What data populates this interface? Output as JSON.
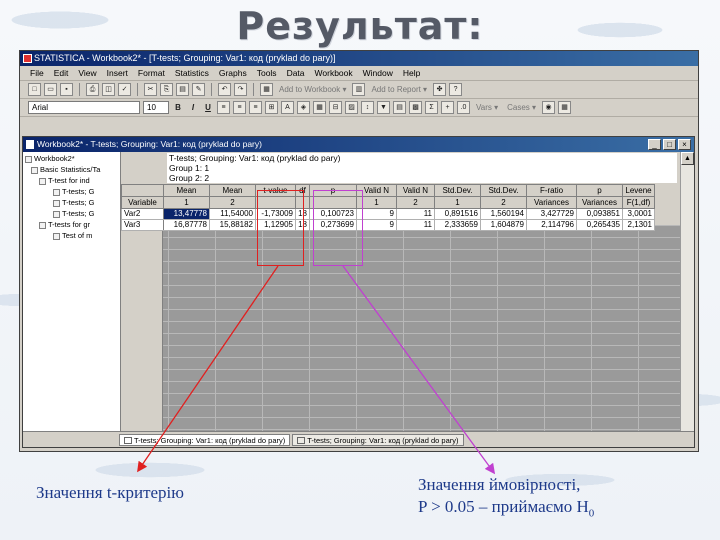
{
  "slide": {
    "title": "Результат:",
    "caption_left": "Значення t-критерію",
    "caption_right_line1": "Значення ймовірності,",
    "caption_right_line2": "P > 0.05 – приймаємо H",
    "caption_right_sub": "0"
  },
  "app": {
    "title": "STATISTICA - Workbook2* - [T-tests; Grouping: Var1: код (pryklad do pary)]",
    "menu": [
      "File",
      "Edit",
      "View",
      "Insert",
      "Format",
      "Statistics",
      "Graphs",
      "Tools",
      "Data",
      "Workbook",
      "Window",
      "Help"
    ],
    "toolbar_add_workbook": "Add to Workbook ▾",
    "toolbar_add_report": "Add to Report ▾",
    "font": "Arial",
    "font_size": "10",
    "format_buttons": [
      "B",
      "I",
      "U"
    ],
    "right_toolbar_vars": "Vars ▾",
    "right_toolbar_cases": "Cases ▾"
  },
  "workbook": {
    "title": "Workbook2* - T-tests; Grouping: Var1: код (pryklad do pary)",
    "tree": [
      "Workbook2*",
      "Basic Statistics/Ta",
      "T-test for ind",
      "T-tests; G",
      "T-tests; G",
      "T-tests; G",
      "T-tests for gr",
      "Test of m"
    ],
    "header_lines": [
      "T-tests; Grouping: Var1: код (pryklad do pary)",
      "Group 1: 1",
      "Group 2: 2"
    ],
    "columns_row1": [
      "",
      "Mean",
      "Mean",
      "t-value",
      "df",
      "p",
      "Valid N",
      "Valid N",
      "Std.Dev.",
      "Std.Dev.",
      "F-ratio",
      "p",
      "Levene"
    ],
    "columns_row2": [
      "Variable",
      "1",
      "2",
      "",
      "",
      "",
      "1",
      "2",
      "1",
      "2",
      "Variances",
      "Variances",
      "F(1,df)"
    ],
    "rows": [
      [
        "Var2",
        "13,47778",
        "11,54000",
        "-1,73009",
        "18",
        "0,100723",
        "9",
        "11",
        "0,891516",
        "1,560194",
        "3,427729",
        "0,093851",
        "3,0001"
      ],
      [
        "Var3",
        "16,87778",
        "15,88182",
        "1,12905",
        "18",
        "0,273699",
        "9",
        "11",
        "2,333659",
        "1,604879",
        "2,114796",
        "0,265435",
        "2,1301"
      ]
    ],
    "tabs": [
      "T-tests; Grouping: Var1: код (pryklad do pary)",
      "T-tests; Grouping: Var1: код (pryklad do pary)"
    ]
  },
  "colors": {
    "highlight_t": "#e02020",
    "highlight_p": "#c040d0",
    "caption_text": "#1e3a8a",
    "titlebar": "#0a246a"
  }
}
